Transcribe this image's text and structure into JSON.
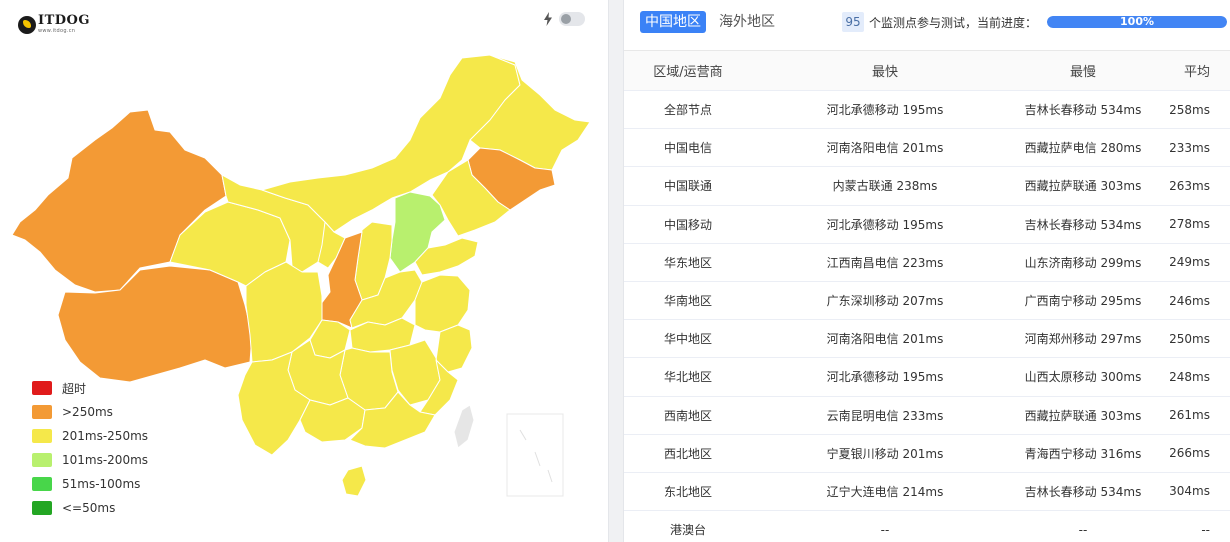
{
  "brand": {
    "name": "ITDOG",
    "url_text": "www.itdog.cn"
  },
  "theme": {
    "icon": "bolt-icon",
    "toggle_on": false
  },
  "map": {
    "legend": [
      {
        "label": "超时",
        "color": "#e01b1b"
      },
      {
        "label": ">250ms",
        "color": "#f39a35"
      },
      {
        "label": "201ms-250ms",
        "color": "#f5e84a"
      },
      {
        "label": "101ms-200ms",
        "color": "#b8f06e"
      },
      {
        "label": "51ms-100ms",
        "color": "#48d64a"
      },
      {
        "label": "<=50ms",
        "color": "#23a623"
      }
    ]
  },
  "tabs": [
    {
      "label": "中国地区",
      "active": true
    },
    {
      "label": "海外地区",
      "active": false
    }
  ],
  "status": {
    "node_count": "95",
    "text": "个监测点参与测试，当前进度：",
    "progress": 100,
    "progress_label": "100%"
  },
  "table": {
    "headers": [
      "区域/运营商",
      "最快",
      "最慢",
      "平均"
    ],
    "rows": [
      [
        "全部节点",
        "河北承德移动 195ms",
        "吉林长春移动 534ms",
        "258ms"
      ],
      [
        "中国电信",
        "河南洛阳电信 201ms",
        "西藏拉萨电信 280ms",
        "233ms"
      ],
      [
        "中国联通",
        "内蒙古联通 238ms",
        "西藏拉萨联通 303ms",
        "263ms"
      ],
      [
        "中国移动",
        "河北承德移动 195ms",
        "吉林长春移动 534ms",
        "278ms"
      ],
      [
        "华东地区",
        "江西南昌电信 223ms",
        "山东济南移动 299ms",
        "249ms"
      ],
      [
        "华南地区",
        "广东深圳移动 207ms",
        "广西南宁移动 295ms",
        "246ms"
      ],
      [
        "华中地区",
        "河南洛阳电信 201ms",
        "河南郑州移动 297ms",
        "250ms"
      ],
      [
        "华北地区",
        "河北承德移动 195ms",
        "山西太原移动 300ms",
        "248ms"
      ],
      [
        "西南地区",
        "云南昆明电信 233ms",
        "西藏拉萨联通 303ms",
        "261ms"
      ],
      [
        "西北地区",
        "宁夏银川移动 201ms",
        "青海西宁移动 316ms",
        "266ms"
      ],
      [
        "东北地区",
        "辽宁大连电信 214ms",
        "吉林长春移动 534ms",
        "304ms"
      ],
      [
        "港澳台",
        "--",
        "--",
        "--"
      ]
    ]
  },
  "colors": {
    "accent": "#3b82f6",
    "over250": "#f39a35",
    "range201_250": "#f5e84a",
    "range101_200": "#b8f06e"
  }
}
